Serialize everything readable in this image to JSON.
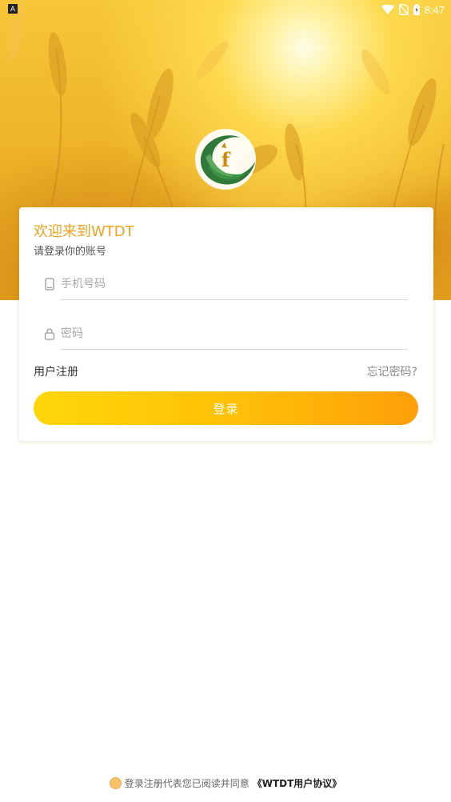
{
  "status_bar": {
    "left_badge": "A",
    "time": "8:47"
  },
  "login_card": {
    "title": "欢迎来到WTDT",
    "subtitle": "请登录你的账号",
    "phone_placeholder": "手机号码",
    "password_placeholder": "密码",
    "register_label": "用户注册",
    "forgot_label": "忘记密码?",
    "login_label": "登录"
  },
  "footer": {
    "agreement_text": "登录注册代表您已阅读并同意",
    "agreement_link": "《WTDT用户协议》"
  },
  "colors": {
    "accent": "#f0a21c",
    "button_start": "#ffd60a",
    "button_end": "#ff9f0a",
    "logo_green": "#2f7a3a"
  },
  "icons": {
    "status_icons": [
      "wifi-icon",
      "no-sim-icon",
      "battery-icon"
    ],
    "phone_field_icon": "phone-icon",
    "password_field_icon": "lock-icon",
    "logo": "app-logo"
  }
}
